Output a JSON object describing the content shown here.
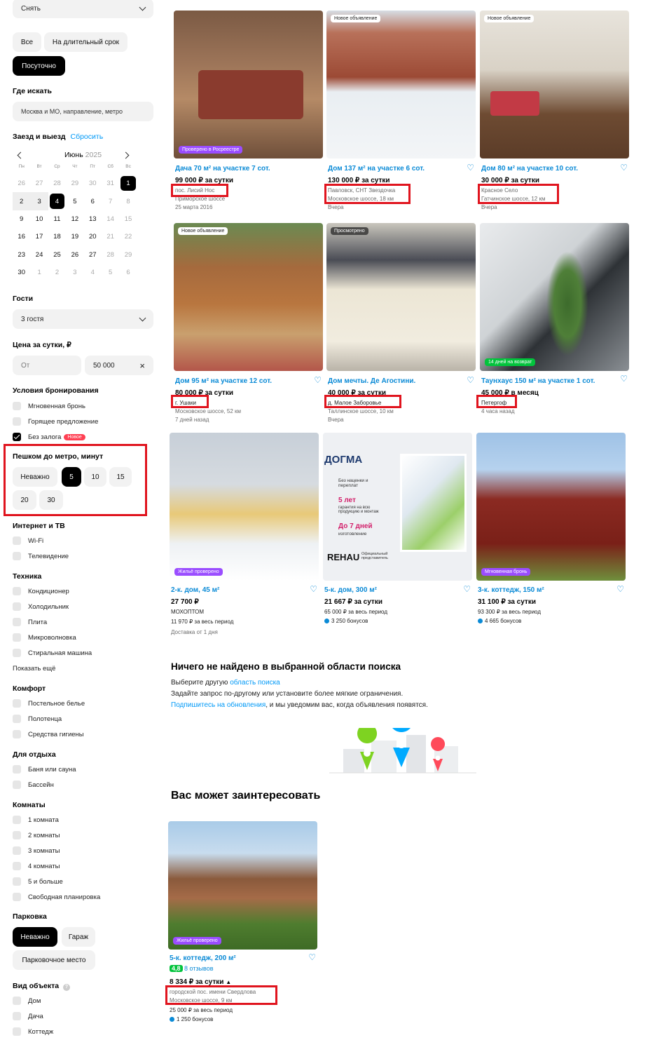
{
  "filters": {
    "deal_type": "Снять",
    "term_all": "Все",
    "term_long": "На длительный срок",
    "term_daily": "Посуточно",
    "where_title": "Где искать",
    "where_placeholder": "Москва и МО, направление, метро",
    "dates_title": "Заезд и выезд",
    "dates_reset": "Сбросить",
    "calendar": {
      "month": "Июнь",
      "year": "2025",
      "weekdays": [
        "Пн",
        "Вт",
        "Ср",
        "Чт",
        "Пт",
        "Сб",
        "Вс"
      ],
      "days": [
        "26",
        "27",
        "28",
        "29",
        "30",
        "31",
        "1",
        "2",
        "3",
        "4",
        "5",
        "6",
        "7",
        "8",
        "9",
        "10",
        "11",
        "12",
        "13",
        "14",
        "15",
        "16",
        "17",
        "18",
        "19",
        "20",
        "21",
        "22",
        "23",
        "24",
        "25",
        "26",
        "27",
        "28",
        "29",
        "30",
        "1",
        "2",
        "3",
        "4",
        "5",
        "6"
      ]
    },
    "guests_title": "Гости",
    "guests_value": "3 гостя",
    "price_title": "Цена за сутки, ₽",
    "price_from_placeholder": "От",
    "price_to_value": "50 000",
    "booking_title": "Условия бронирования",
    "booking_instant": "Мгновенная бронь",
    "booking_hot": "Горящее предложение",
    "booking_no_deposit": "Без залога",
    "booking_new_badge": "Новое",
    "metro_title": "Пешком до метро, минут",
    "metro_options": [
      "Неважно",
      "5",
      "10",
      "15",
      "20",
      "30"
    ],
    "internet_title": "Интернет и ТВ",
    "internet_wifi": "Wi-Fi",
    "internet_tv": "Телевидение",
    "tech_title": "Техника",
    "tech_items": [
      "Кондиционер",
      "Холодильник",
      "Плита",
      "Микроволновка",
      "Стиральная машина"
    ],
    "show_more": "Показать ещё",
    "comfort_title": "Комфорт",
    "comfort_items": [
      "Постельное белье",
      "Полотенца",
      "Средства гигиены"
    ],
    "rest_title": "Для отдыха",
    "rest_items": [
      "Баня или сауна",
      "Бассейн"
    ],
    "rooms_title": "Комнаты",
    "rooms_items": [
      "1 комната",
      "2 комнаты",
      "3 комнаты",
      "4 комнаты",
      "5 и больше",
      "Свободная планировка"
    ],
    "parking_title": "Парковка",
    "parking_any": "Неважно",
    "parking_garage": "Гараж",
    "parking_spot": "Парковочное место",
    "object_title": "Вид объекта",
    "object_items": [
      "Дом",
      "Дача",
      "Коттедж"
    ]
  },
  "listings": [
    {
      "tag": "Проверено в Росреестре",
      "title": "Дача 70 м² на участке 7 сот.",
      "price": "99 000 ₽ за сутки",
      "location": "пос. Лисий Нос",
      "line2": "Приморское шоссе",
      "date": "25 марта 2016"
    },
    {
      "tag": "Новое объявление",
      "title": "Дом 137 м² на участке 6 сот.",
      "price": "130 000 ₽ за сутки",
      "location": "Павловск, СНТ Звездочка",
      "line2": "Московское шоссе, 18 км",
      "date": "Вчера"
    },
    {
      "tag": "Новое объявление",
      "title": "Дом 80 м² на участке 10 сот.",
      "price": "30 000 ₽ за сутки",
      "location": "Красное Село",
      "line2": "Гатчинское шоссе, 12 км",
      "date": "Вчера"
    },
    {
      "tag": "Новое объявление",
      "title": "Дом 95 м² на участке 12 сот.",
      "price": "80 000 ₽ за сутки",
      "location": "г. Ушаки",
      "line2": "Московское шоссе, 52 км",
      "date": "7 дней назад"
    },
    {
      "tag": "Просмотрено",
      "title": "Дом мечты. Де Агостини.",
      "price": "40 000 ₽ за сутки",
      "location": "д. Малое Заборовье",
      "line2": "Таллинское шоссе, 10 км",
      "date": "Вчера"
    },
    {
      "tag": "14 дней на возврат",
      "title": "Таунхаус 150 м² на участке 1 сот.",
      "price": "45 000 ₽ в месяц",
      "location": "Петергоф",
      "line2": "",
      "date": "4 часа назад"
    },
    {
      "tag": "Жильё проверено",
      "title": "2-к. дом, 45 м²",
      "price": "27 700 ₽",
      "location": "МОХОПТОМ",
      "line2": "11 970 ₽ за весь период",
      "date": "Доставка от 1 дня"
    },
    {
      "tag": "",
      "title": "5-к. дом, 300 м²",
      "price": "21 667 ₽ за сутки",
      "location": "65 000 ₽ за весь период",
      "line2": "3 250 бонусов",
      "date": ""
    },
    {
      "tag": "Мгновенная бронь",
      "title": "3-к. коттедж, 150 м²",
      "price": "31 100 ₽ за сутки",
      "location": "93 300 ₽ за весь период",
      "line2": "4 665 бонусов",
      "date": ""
    }
  ],
  "ad": {
    "brand": "ДОГМА",
    "line1": "Без наценки и переплат",
    "line2": "5 лет",
    "line3": "гарантия на всю продукцию и монтаж",
    "line4": "До 7 дней",
    "line5": "изготовление",
    "rehau": "REHAU",
    "rehau_sub": "Официальный представитель"
  },
  "empty": {
    "title": "Ничего не найдено в выбранной области поиска",
    "line1_prefix": "Выберите другую ",
    "line1_link": "область поиска",
    "line2": "Задайте запрос по-другому или установите более мягкие ограничения.",
    "line3_link": "Подпишитесь на обновления",
    "line3_suffix": ", и мы уведомим вас, когда объявления появятся."
  },
  "recommend": {
    "title": "Вас может заинтересовать",
    "tag": "Жильё проверено",
    "card_title": "5-к. коттедж, 200 м²",
    "rating": "4,8",
    "reviews": "8 отзывов",
    "price": "8 334 ₽ за сутки",
    "location": "городской пос. имени Свердлова",
    "line2": "Московское шоссе, 9 км",
    "total": "25 000 ₽ за весь период",
    "bonus": "1 250 бонусов"
  }
}
